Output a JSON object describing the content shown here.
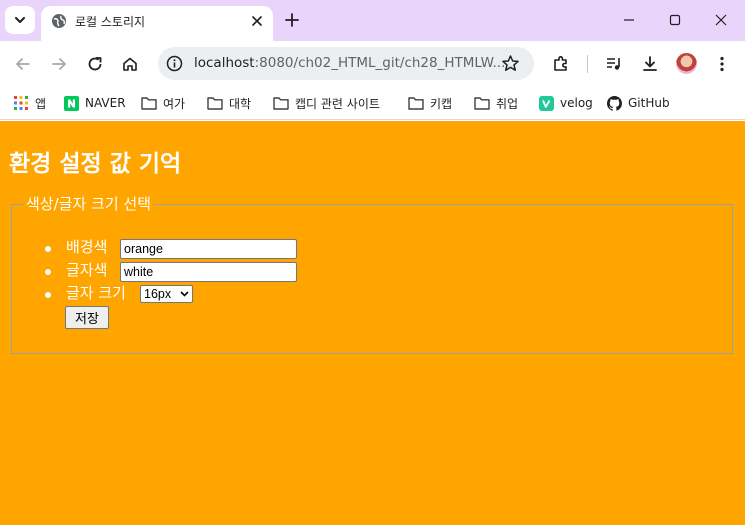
{
  "tab": {
    "title": "로컬 스토리지"
  },
  "toolbar": {
    "url_host": "localhost",
    "url_rest": ":8080/ch02_HTML_git/ch28_HTMLW..."
  },
  "bookmarks": [
    {
      "label": "앱",
      "icon": "apps-grid-icon"
    },
    {
      "label": "NAVER",
      "icon": "naver-icon"
    },
    {
      "label": "여가",
      "icon": "folder-icon"
    },
    {
      "label": "대학",
      "icon": "folder-icon"
    },
    {
      "label": "캡디 관련 사이트",
      "icon": "folder-icon"
    },
    {
      "label": "키캡",
      "icon": "folder-icon"
    },
    {
      "label": "취업",
      "icon": "folder-icon"
    },
    {
      "label": "velog",
      "icon": "velog-icon"
    },
    {
      "label": "GitHub",
      "icon": "github-icon"
    }
  ],
  "page": {
    "title": "환경 설정 값 기억",
    "legend": "색상/글자 크기 선택",
    "options": [
      {
        "label": "배경색",
        "value": "orange"
      },
      {
        "label": "글자색",
        "value": "white"
      },
      {
        "label": "글자 크기",
        "value": "16px"
      }
    ],
    "save_label": "저장"
  },
  "colors": {
    "page_background": "#ffa500",
    "text": "#ffffff",
    "titlebar": "#e9d4fb"
  }
}
